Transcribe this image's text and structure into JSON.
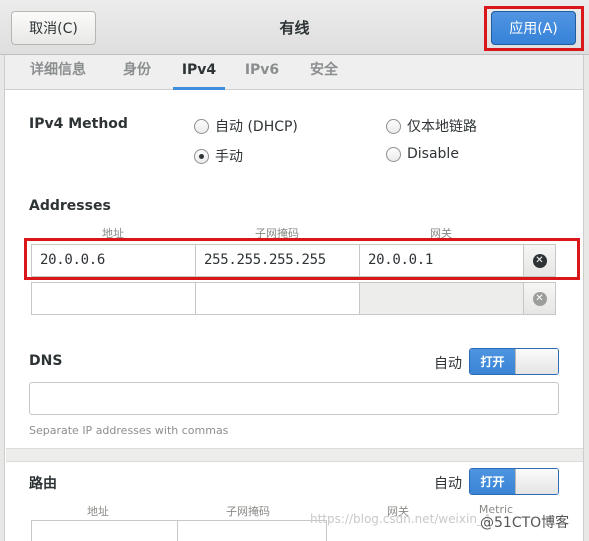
{
  "header": {
    "cancel_label": "取消(C)",
    "title": "有线",
    "apply_label": "应用(A)"
  },
  "tabs": [
    {
      "label": "详细信息"
    },
    {
      "label": "身份"
    },
    {
      "label": "IPv4"
    },
    {
      "label": "IPv6"
    },
    {
      "label": "安全"
    }
  ],
  "active_tab": "IPv4",
  "ipv4": {
    "method_label": "IPv4 Method",
    "methods": [
      {
        "label": "自动 (DHCP)",
        "checked": false
      },
      {
        "label": "仅本地链路",
        "checked": false
      },
      {
        "label": "手动",
        "checked": true
      },
      {
        "label": "Disable",
        "checked": false
      }
    ]
  },
  "addresses": {
    "title": "Addresses",
    "columns": [
      "地址",
      "子网掩码",
      "网关"
    ],
    "rows": [
      {
        "address": "20.0.0.6",
        "netmask": "255.255.255.255",
        "gateway": "20.0.0.1"
      },
      {
        "address": "",
        "netmask": "",
        "gateway": ""
      }
    ]
  },
  "dns": {
    "title": "DNS",
    "auto_label": "自动",
    "switch_label": "打开",
    "value": "",
    "hint": "Separate IP addresses with commas"
  },
  "routes": {
    "title": "路由",
    "auto_label": "自动",
    "switch_label": "打开",
    "columns": [
      "地址",
      "子网掩码",
      "网关",
      "Metric"
    ]
  },
  "watermark": {
    "url_text": "https://blog.csdn.net/weixin_4",
    "brand_text": "@51CTO博客"
  },
  "colors": {
    "accent": "#3583d8",
    "highlight_box": "#d9161a"
  }
}
